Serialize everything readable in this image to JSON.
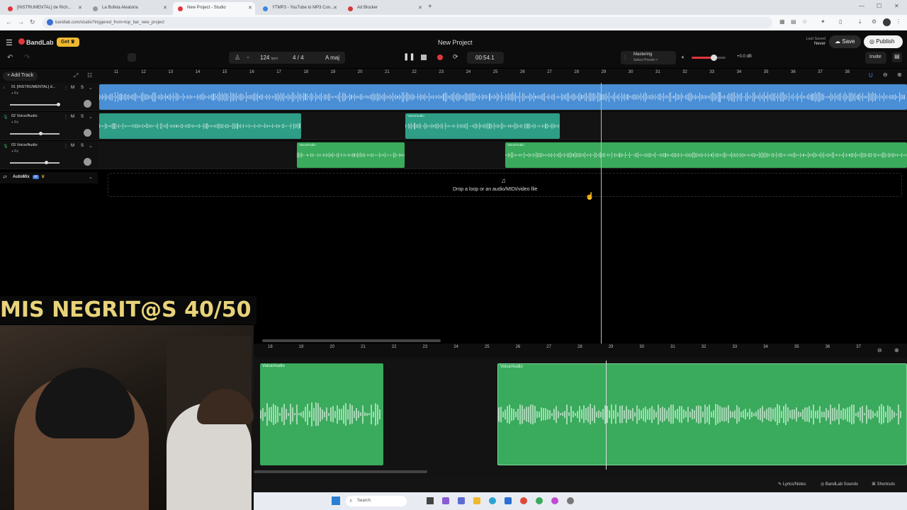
{
  "browser": {
    "tabs": [
      {
        "title": "[INSTRUMENTAL] de Rich...",
        "color": "#e0373a",
        "active": false
      },
      {
        "title": "La Bufeta Aleatoria",
        "color": "#999999",
        "active": false
      },
      {
        "title": "New Project - Studio",
        "color": "#e0373a",
        "active": true
      },
      {
        "title": "YTMP3 - YouTube to MP3 Con...",
        "color": "#3b87e0",
        "active": false
      },
      {
        "title": "Ad Blocker",
        "color": "#d03a3a",
        "active": false
      }
    ],
    "url": "bandlab.com/studio?triggered_from=top_bar_new_project"
  },
  "app": {
    "logo": "BandLab",
    "get_label": "Get",
    "project_title": "New Project",
    "last_saved_label": "Last Saved",
    "last_saved_value": "Never",
    "save_label": "Save",
    "publish_label": "Publish",
    "invite_label": "Invite",
    "bpm": "124",
    "bpm_unit": "bpm",
    "time_sig": "4 / 4",
    "key": "A maj",
    "time": "00:54.1",
    "mastering_label": "Mastering",
    "mastering_preset": "Select Preset >",
    "volume_db": "+0.0 dB",
    "add_track_label": "Add Track",
    "drop_hint": "Drop a loop or an audio/MIDI/video file",
    "automix_label": "AutoMix",
    "automix_badge": "AI"
  },
  "ruler_top": [
    "11",
    "12",
    "13",
    "14",
    "15",
    "16",
    "17",
    "18",
    "19",
    "20",
    "21",
    "22",
    "23",
    "24",
    "25",
    "26",
    "27",
    "28",
    "29",
    "30",
    "31",
    "32",
    "33",
    "34",
    "35",
    "36",
    "37",
    "38"
  ],
  "ruler_bottom": [
    "18",
    "19",
    "20",
    "21",
    "22",
    "23",
    "24",
    "25",
    "26",
    "27",
    "28",
    "29",
    "30",
    "31",
    "32",
    "33",
    "34",
    "35",
    "36",
    "37"
  ],
  "tracks": [
    {
      "name": "01 [INSTRUMENTAL] d...",
      "fx": "+ Fx",
      "m": "M",
      "s": "S",
      "color": "#4a8fd6",
      "clips": [
        {
          "label": ""
        }
      ]
    },
    {
      "name": "02 Voice/Audio",
      "fx": "+ Fx",
      "m": "M",
      "s": "S",
      "color": "#2e9e86",
      "clips": [
        {
          "label": ""
        },
        {
          "label": "Voice/Audio"
        }
      ]
    },
    {
      "name": "03 Voice/Audio",
      "fx": "+ Fx",
      "m": "M",
      "s": "S",
      "color": "#3aaa5c",
      "clips": [
        {
          "label": "Voice/Audio"
        },
        {
          "label": "Voice/Audio"
        }
      ]
    }
  ],
  "editor_clips": [
    {
      "label": "Voice/Audio"
    },
    {
      "label": "Voice/Audio"
    }
  ],
  "footer": {
    "lyrics": "Lyrics/Notes",
    "sounds": "BandLab Sounds",
    "shortcuts": "Shortcuts"
  },
  "taskbar": {
    "search": "Search"
  },
  "overlay": {
    "title": "MIS NEGRIT@S 40/50"
  }
}
